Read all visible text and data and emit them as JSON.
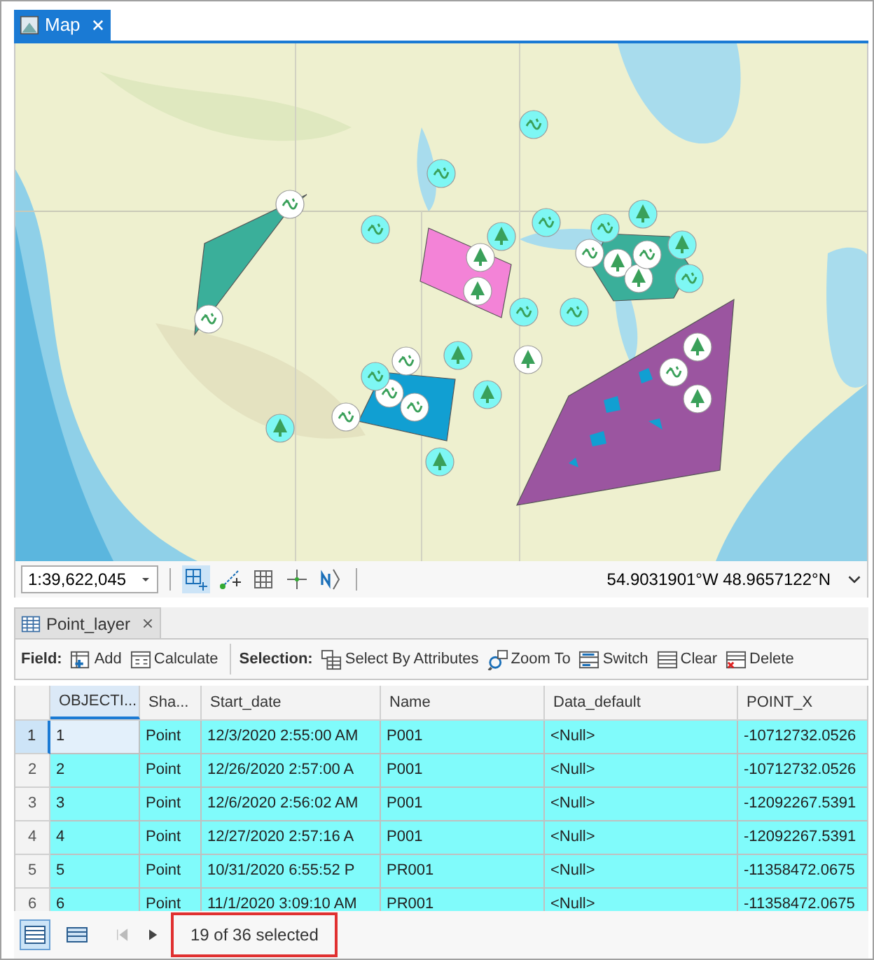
{
  "map_tab": {
    "title": "Map",
    "selected": true
  },
  "map_status": {
    "scale": "1:39,622,045",
    "tools": [
      {
        "kind": "grid-add",
        "selected": true
      },
      {
        "kind": "snap",
        "selected": false
      },
      {
        "kind": "grid",
        "selected": false
      },
      {
        "kind": "crosshair",
        "selected": false
      },
      {
        "kind": "north",
        "selected": false
      }
    ],
    "coordinates": "54.9031901°W 48.9657122°N"
  },
  "table_tab": {
    "title": "Point_layer"
  },
  "toolbar": [
    {
      "label": "Field:",
      "buttons": [
        {
          "kind": "add",
          "label": "Add"
        },
        {
          "kind": "calculate",
          "label": "Calculate"
        }
      ]
    },
    {
      "label": "Selection:",
      "buttons": [
        {
          "kind": "select",
          "label": "Select By Attributes"
        },
        {
          "kind": "zoom",
          "label": "Zoom To"
        },
        {
          "kind": "switch",
          "label": "Switch"
        },
        {
          "kind": "clear",
          "label": "Clear"
        },
        {
          "kind": "delete",
          "label": "Delete"
        }
      ]
    }
  ],
  "table": {
    "columns": [
      {
        "label": "OBJECTI...",
        "selected": true
      },
      {
        "label": "Sha...",
        "selected": false
      },
      {
        "label": "Start_date",
        "selected": false
      },
      {
        "label": "Name",
        "selected": false
      },
      {
        "label": "Data_default",
        "selected": false
      },
      {
        "label": "POINT_X",
        "selected": false
      }
    ],
    "rows": [
      {
        "number": "1",
        "selected": true,
        "active": true,
        "cells": [
          "1",
          "Point",
          "12/3/2020 2:55:00 AM",
          "P001",
          "<Null>",
          "-10712732.0526"
        ]
      },
      {
        "number": "2",
        "selected": true,
        "active": false,
        "cells": [
          "2",
          "Point",
          "12/26/2020 2:57:00 A",
          "P001",
          "<Null>",
          "-10712732.0526"
        ]
      },
      {
        "number": "3",
        "selected": true,
        "active": false,
        "cells": [
          "3",
          "Point",
          "12/6/2020 2:56:02 AM",
          "P001",
          "<Null>",
          "-12092267.5391"
        ]
      },
      {
        "number": "4",
        "selected": true,
        "active": false,
        "cells": [
          "4",
          "Point",
          "12/27/2020 2:57:16 A",
          "P001",
          "<Null>",
          "-12092267.5391"
        ]
      },
      {
        "number": "5",
        "selected": true,
        "active": false,
        "cells": [
          "5",
          "Point",
          "10/31/2020 6:55:52 P",
          "PR001",
          "<Null>",
          "-11358472.0675"
        ]
      },
      {
        "number": "6",
        "selected": true,
        "active": false,
        "cells": [
          "6",
          "Point",
          "11/1/2020 3:09:10 AM",
          "PR001",
          "<Null>",
          "-11358472.0675"
        ]
      }
    ]
  },
  "footer": {
    "views": [
      {
        "kind": "all",
        "selected": true
      },
      {
        "kind": "selected",
        "selected": false
      }
    ],
    "status": "19 of 36 selected",
    "highlighted": true
  }
}
